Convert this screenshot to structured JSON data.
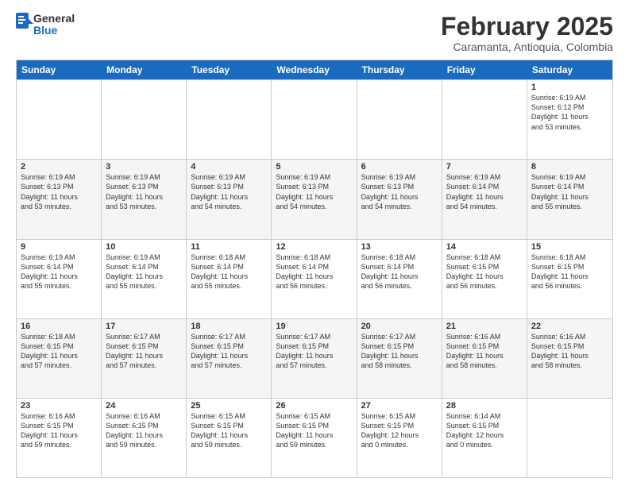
{
  "logo": {
    "general": "General",
    "blue": "Blue"
  },
  "header": {
    "title": "February 2025",
    "subtitle": "Caramanta, Antioquia, Colombia"
  },
  "weekdays": [
    "Sunday",
    "Monday",
    "Tuesday",
    "Wednesday",
    "Thursday",
    "Friday",
    "Saturday"
  ],
  "rows": [
    [
      {
        "day": "",
        "info": ""
      },
      {
        "day": "",
        "info": ""
      },
      {
        "day": "",
        "info": ""
      },
      {
        "day": "",
        "info": ""
      },
      {
        "day": "",
        "info": ""
      },
      {
        "day": "",
        "info": ""
      },
      {
        "day": "1",
        "info": "Sunrise: 6:19 AM\nSunset: 6:12 PM\nDaylight: 11 hours\nand 53 minutes."
      }
    ],
    [
      {
        "day": "2",
        "info": "Sunrise: 6:19 AM\nSunset: 6:13 PM\nDaylight: 11 hours\nand 53 minutes."
      },
      {
        "day": "3",
        "info": "Sunrise: 6:19 AM\nSunset: 6:13 PM\nDaylight: 11 hours\nand 53 minutes."
      },
      {
        "day": "4",
        "info": "Sunrise: 6:19 AM\nSunset: 6:13 PM\nDaylight: 11 hours\nand 54 minutes."
      },
      {
        "day": "5",
        "info": "Sunrise: 6:19 AM\nSunset: 6:13 PM\nDaylight: 11 hours\nand 54 minutes."
      },
      {
        "day": "6",
        "info": "Sunrise: 6:19 AM\nSunset: 6:13 PM\nDaylight: 11 hours\nand 54 minutes."
      },
      {
        "day": "7",
        "info": "Sunrise: 6:19 AM\nSunset: 6:14 PM\nDaylight: 11 hours\nand 54 minutes."
      },
      {
        "day": "8",
        "info": "Sunrise: 6:19 AM\nSunset: 6:14 PM\nDaylight: 11 hours\nand 55 minutes."
      }
    ],
    [
      {
        "day": "9",
        "info": "Sunrise: 6:19 AM\nSunset: 6:14 PM\nDaylight: 11 hours\nand 55 minutes."
      },
      {
        "day": "10",
        "info": "Sunrise: 6:19 AM\nSunset: 6:14 PM\nDaylight: 11 hours\nand 55 minutes."
      },
      {
        "day": "11",
        "info": "Sunrise: 6:18 AM\nSunset: 6:14 PM\nDaylight: 11 hours\nand 55 minutes."
      },
      {
        "day": "12",
        "info": "Sunrise: 6:18 AM\nSunset: 6:14 PM\nDaylight: 11 hours\nand 56 minutes."
      },
      {
        "day": "13",
        "info": "Sunrise: 6:18 AM\nSunset: 6:14 PM\nDaylight: 11 hours\nand 56 minutes."
      },
      {
        "day": "14",
        "info": "Sunrise: 6:18 AM\nSunset: 6:15 PM\nDaylight: 11 hours\nand 56 minutes."
      },
      {
        "day": "15",
        "info": "Sunrise: 6:18 AM\nSunset: 6:15 PM\nDaylight: 11 hours\nand 56 minutes."
      }
    ],
    [
      {
        "day": "16",
        "info": "Sunrise: 6:18 AM\nSunset: 6:15 PM\nDaylight: 11 hours\nand 57 minutes."
      },
      {
        "day": "17",
        "info": "Sunrise: 6:17 AM\nSunset: 6:15 PM\nDaylight: 11 hours\nand 57 minutes."
      },
      {
        "day": "18",
        "info": "Sunrise: 6:17 AM\nSunset: 6:15 PM\nDaylight: 11 hours\nand 57 minutes."
      },
      {
        "day": "19",
        "info": "Sunrise: 6:17 AM\nSunset: 6:15 PM\nDaylight: 11 hours\nand 57 minutes."
      },
      {
        "day": "20",
        "info": "Sunrise: 6:17 AM\nSunset: 6:15 PM\nDaylight: 11 hours\nand 58 minutes."
      },
      {
        "day": "21",
        "info": "Sunrise: 6:16 AM\nSunset: 6:15 PM\nDaylight: 11 hours\nand 58 minutes."
      },
      {
        "day": "22",
        "info": "Sunrise: 6:16 AM\nSunset: 6:15 PM\nDaylight: 11 hours\nand 58 minutes."
      }
    ],
    [
      {
        "day": "23",
        "info": "Sunrise: 6:16 AM\nSunset: 6:15 PM\nDaylight: 11 hours\nand 59 minutes."
      },
      {
        "day": "24",
        "info": "Sunrise: 6:16 AM\nSunset: 6:15 PM\nDaylight: 11 hours\nand 59 minutes."
      },
      {
        "day": "25",
        "info": "Sunrise: 6:15 AM\nSunset: 6:15 PM\nDaylight: 11 hours\nand 59 minutes."
      },
      {
        "day": "26",
        "info": "Sunrise: 6:15 AM\nSunset: 6:15 PM\nDaylight: 11 hours\nand 59 minutes."
      },
      {
        "day": "27",
        "info": "Sunrise: 6:15 AM\nSunset: 6:15 PM\nDaylight: 12 hours\nand 0 minutes."
      },
      {
        "day": "28",
        "info": "Sunrise: 6:14 AM\nSunset: 6:15 PM\nDaylight: 12 hours\nand 0 minutes."
      },
      {
        "day": "",
        "info": ""
      }
    ]
  ]
}
